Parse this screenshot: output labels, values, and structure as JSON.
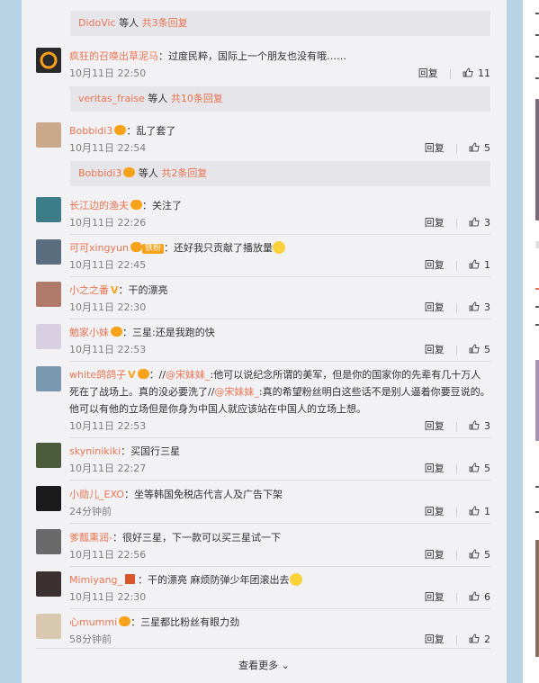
{
  "sub_threads": [
    {
      "name": "DidoVic",
      "mid": " 等人 ",
      "count": "共3条回复"
    },
    {
      "name": "veritas_fraise",
      "mid": " 等人 ",
      "count": "共10条回复"
    },
    {
      "name": "Bobbidi3",
      "mid": " 等人 ",
      "count": "共2条回复"
    }
  ],
  "reply_label": "回复",
  "comments": [
    {
      "user": "疯狂的召唤出草泥马",
      "text": "：过度民粹，国际上一个朋友也没有哦……",
      "time": "10月11日 22:50",
      "likes": "11"
    },
    {
      "user": "Bobbidi3",
      "text": "：乱了套了",
      "time": "10月11日 22:54",
      "likes": "5"
    },
    {
      "user": "长江边的渔夫",
      "text": "：关注了",
      "time": "10月11日 22:26",
      "likes": "3"
    },
    {
      "user": "可可xingyun",
      "fan": "铁粉",
      "text": "：还好我只贡献了播放量",
      "time": "10月11日 22:45",
      "likes": "1"
    },
    {
      "user": "小之之番",
      "text": "：干的漂亮",
      "time": "10月11日 22:30",
      "likes": "3"
    },
    {
      "user": "勉家小妹",
      "text": "：三星:还是我跑的快",
      "time": "10月11日 22:53",
      "likes": "5"
    },
    {
      "user": "white鸽鸽子",
      "p1": "：//",
      "at1": "@宋妹妹_",
      "p2": ":他可以说纪念所谓的美军，但是你的国家你的先辈有几十万人死在了战场上。真的没必要洗了//",
      "at2": "@宋妹妹_",
      "p3": ":真的希望粉丝明白这些话不是别人逼着你要豆说的。他可以有他的立场但是你身为中国人就应该站在中国人的立场上想。",
      "time": "10月11日 22:53",
      "likes": "3"
    },
    {
      "user": "skyninikiki",
      "text": "：买国行三星",
      "time": "10月11日 22:27",
      "likes": "5"
    },
    {
      "user": "小勋儿_EXO",
      "text": "：坐等韩国免税店代言人及广告下架",
      "time": "24分钟前",
      "likes": "1"
    },
    {
      "user": "爹瓢熏润-",
      "text": "：很好三星，下一款可以买三星试一下",
      "time": "10月11日 22:56",
      "likes": "5"
    },
    {
      "user": "Mimiyang_",
      "text": "：干的漂亮 麻烦防弹少年团滚出去",
      "time": "10月11日 22:30",
      "likes": "6"
    },
    {
      "user": "心mummi",
      "text": "：三星都比粉丝有眼力劲",
      "time": "58分钟前",
      "likes": "2"
    }
  ],
  "more": "查看更多",
  "colors": {
    "accent": "#eb7350",
    "badge": "#f7a21b",
    "background": "#b9d3e6"
  }
}
